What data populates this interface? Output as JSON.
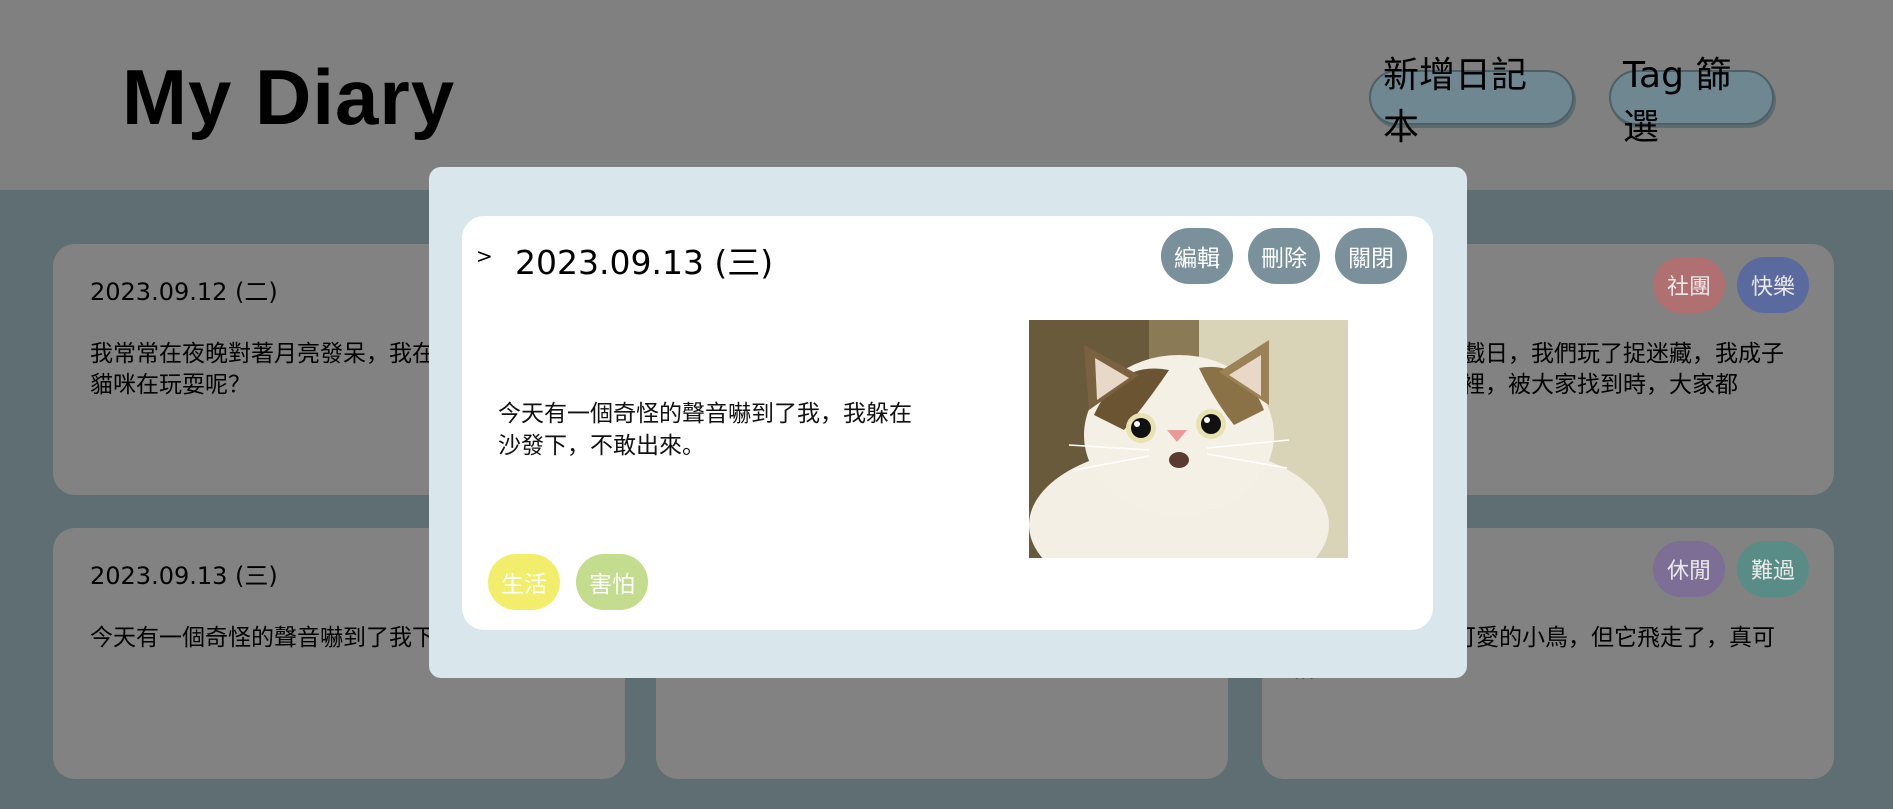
{
  "header": {
    "title": "My Diary",
    "new_diary_label": "新增日記本",
    "tag_filter_label": "Tag 篩選"
  },
  "cards": [
    {
      "date": "2023.09.12 (二)",
      "text": "我常常在夜晚對著月亮發呆，我在想有沒有其他貓咪在玩耍呢？",
      "tags": []
    },
    {
      "date": "",
      "text": "",
      "tags": []
    },
    {
      "date": "",
      "text": "戲日，我們玩了捉迷藏，我成子裡，被大家找到時，大家都",
      "tags": [
        {
          "label": "社團",
          "color": "#b06f70"
        },
        {
          "label": "快樂",
          "color": "#5a6a9e"
        }
      ]
    },
    {
      "date": "2023.09.13 (三)",
      "text": "今天有一個奇怪的聲音嚇到了我下，不敢出來。",
      "tags": []
    },
    {
      "date": "",
      "text": "",
      "tags": []
    },
    {
      "date": "",
      "text": "陽台上發現一隻可愛的小鳥，但它飛走了，真可惜。",
      "tags": [
        {
          "label": "休閒",
          "color": "#7c6e94"
        },
        {
          "label": "難過",
          "color": "#5a8c87"
        }
      ]
    }
  ],
  "modal": {
    "caret": ">",
    "date": "2023.09.13 (三)",
    "edit_label": "編輯",
    "delete_label": "刪除",
    "close_label": "關閉",
    "text": "今天有一個奇怪的聲音嚇到了我，我躲在沙發下，不敢出來。",
    "tags": [
      {
        "label": "生活",
        "color": "#f2ee6b"
      },
      {
        "label": "害怕",
        "color": "#c4dc8d"
      }
    ]
  },
  "colors": {
    "overlay": "#808080",
    "modal_bg": "#d9e6ec",
    "action_button": "#7a919b"
  }
}
